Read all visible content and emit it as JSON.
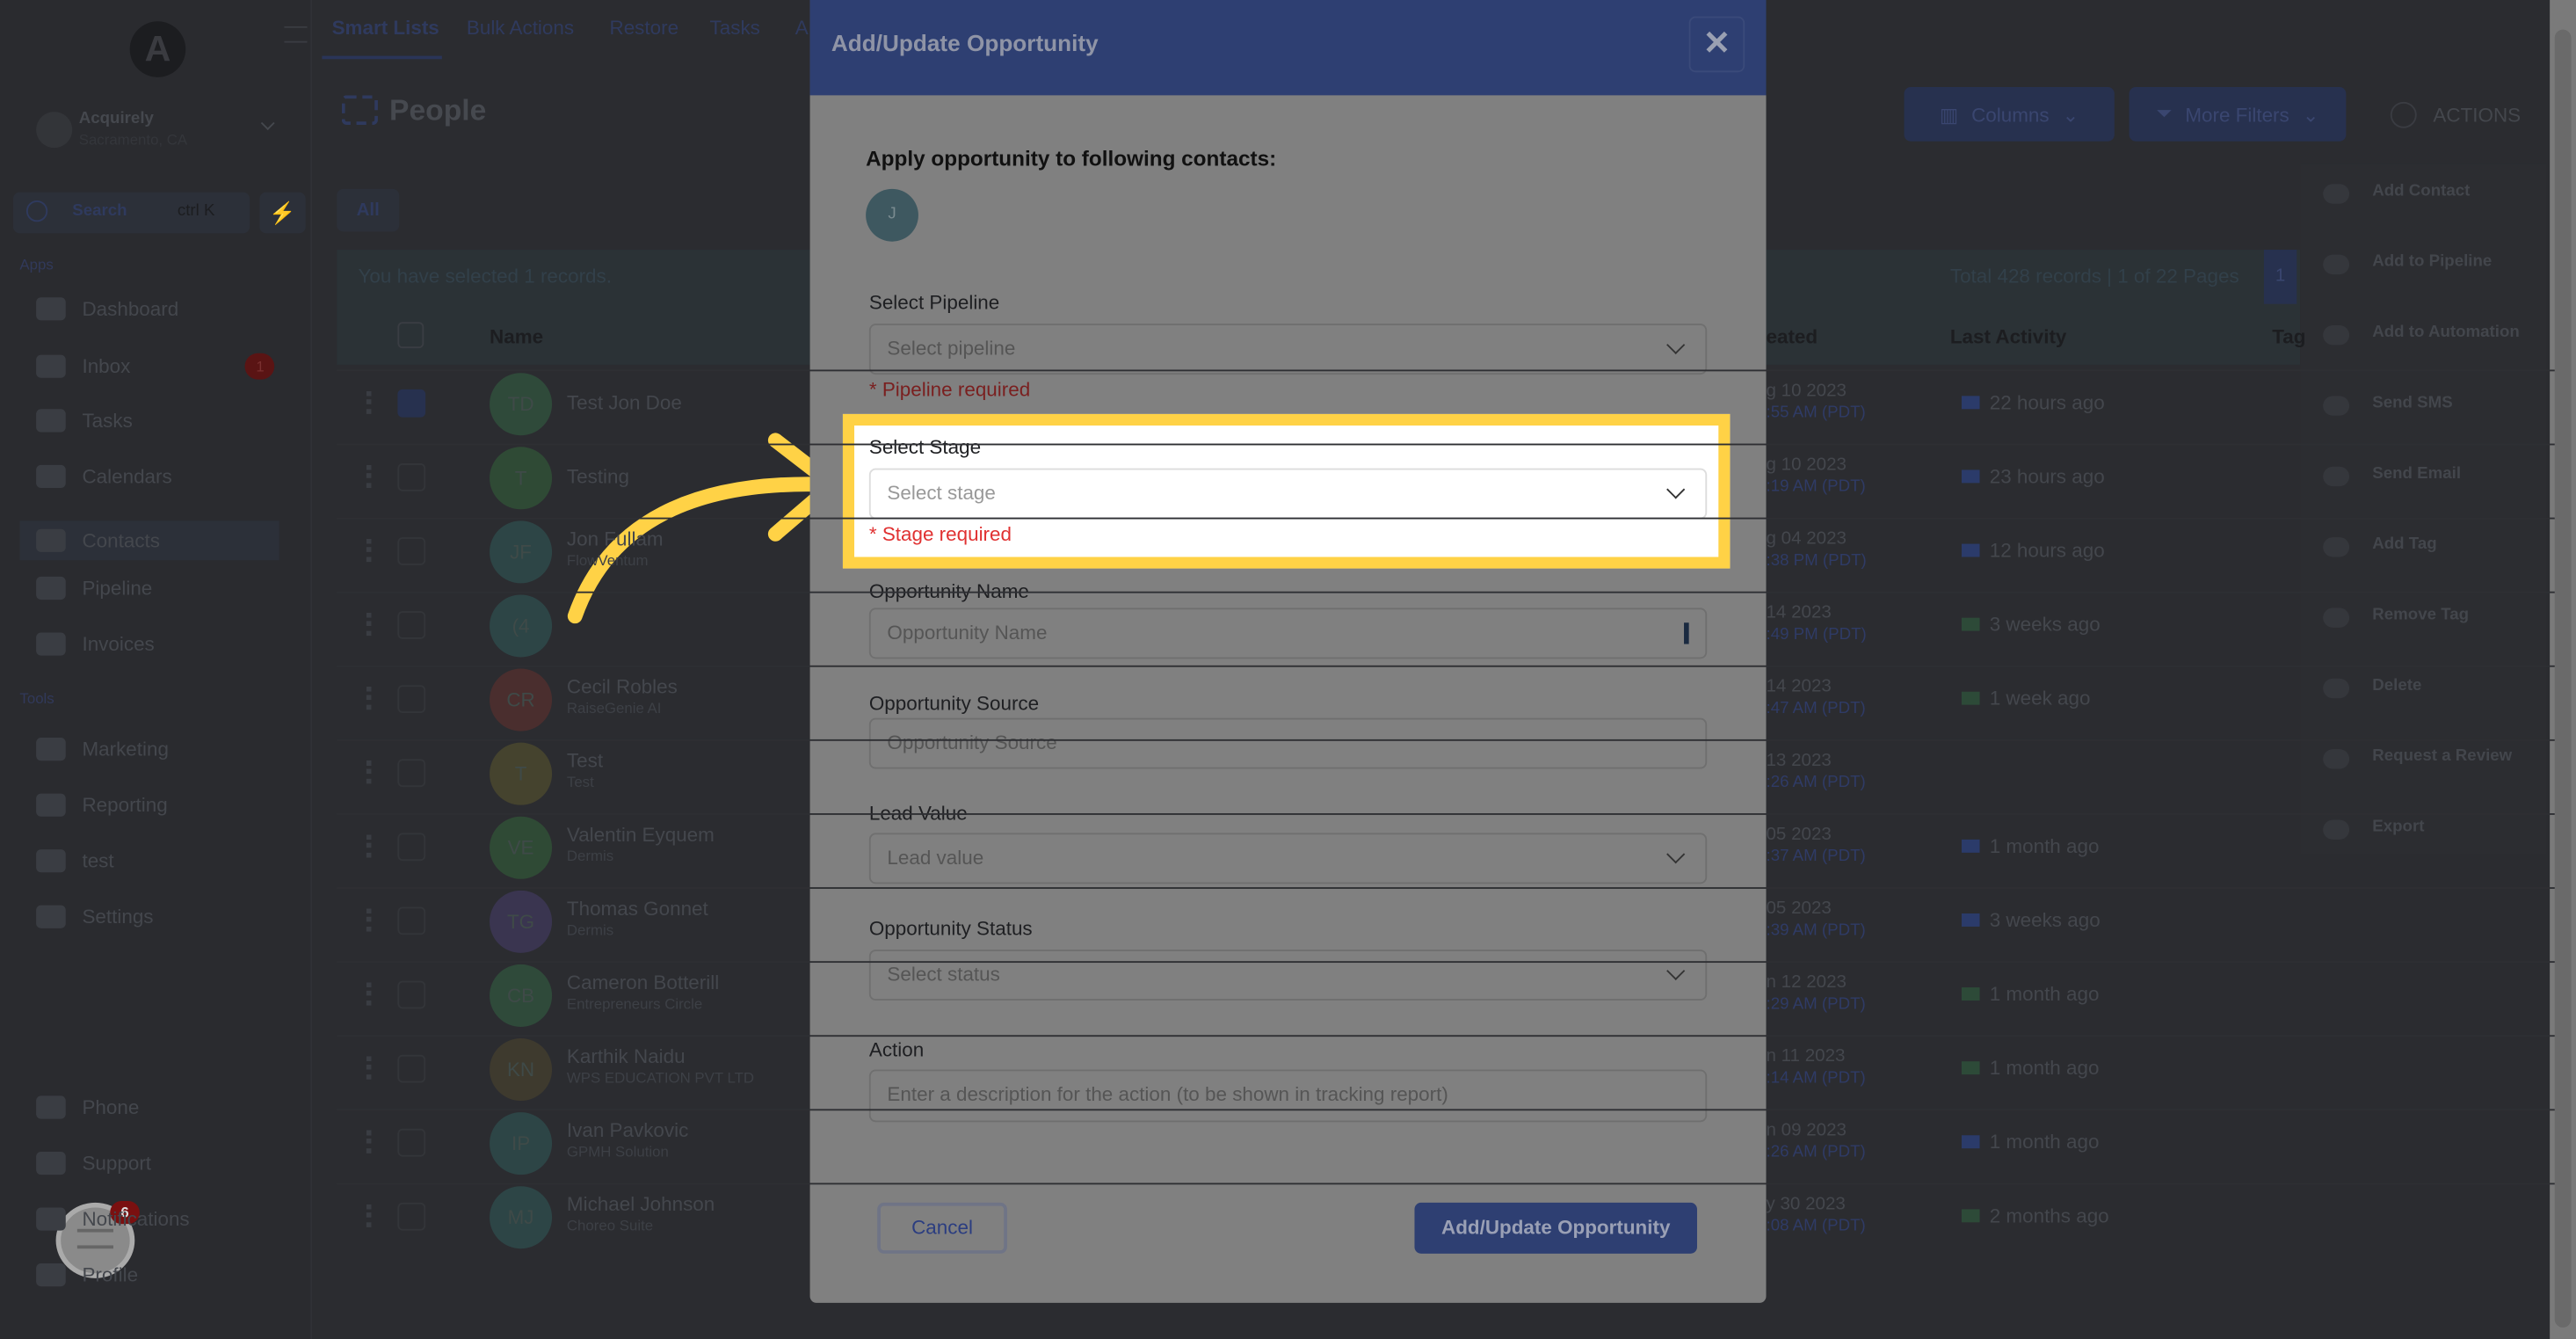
{
  "sidebar": {
    "logo": "A",
    "account_name": "Acquirely",
    "account_location": "Sacramento, CA",
    "search_label": "Search",
    "search_shortcut": "ctrl K",
    "section_apps": "Apps",
    "section_tools": "Tools",
    "apps": [
      {
        "label": "Dashboard"
      },
      {
        "label": "Inbox",
        "badge": "1"
      },
      {
        "label": "Tasks"
      },
      {
        "label": "Calendars"
      },
      {
        "label": "Contacts",
        "active": true
      },
      {
        "label": "Pipeline"
      },
      {
        "label": "Invoices"
      }
    ],
    "tools": [
      {
        "label": "Marketing"
      },
      {
        "label": "Reporting"
      },
      {
        "label": "test"
      },
      {
        "label": "Settings"
      }
    ],
    "bottom": [
      {
        "label": "Phone"
      },
      {
        "label": "Support"
      },
      {
        "label": "Notifications"
      },
      {
        "label": "Profile"
      }
    ],
    "chat_badge": "6"
  },
  "top_tabs": [
    "Smart Lists",
    "Bulk Actions",
    "Restore",
    "Tasks",
    "A"
  ],
  "page_title": "People",
  "toolbar": {
    "columns": "Columns",
    "more_filters": "More Filters",
    "actions": "ACTIONS"
  },
  "actions_menu": [
    "Add Contact",
    "Add to Pipeline",
    "Add to Automation",
    "Send SMS",
    "Send Email",
    "Add Tag",
    "Remove Tag",
    "Delete",
    "Request a Review",
    "Export"
  ],
  "list": {
    "filter_tab": "All",
    "selected_text": "You have selected 1 records.",
    "total_text": "Total 428 records | 1 of 22 Pages",
    "page": "1",
    "headers": {
      "name": "Name",
      "created": "eated",
      "last_activity": "Last Activity",
      "tags": "Tag"
    },
    "rows": [
      {
        "initials": "TD",
        "name": "Test Jon Doe",
        "sub": "",
        "date": "g 10 2023",
        "time": ":55 AM (PDT)",
        "activity": "22 hours ago",
        "icon": "email",
        "color": "#2f4a3a",
        "checked": true
      },
      {
        "initials": "T",
        "name": "Testing",
        "sub": "",
        "date": "g 10 2023",
        "time": ":19 AM (PDT)",
        "activity": "23 hours ago",
        "icon": "email",
        "color": "#2f4a35"
      },
      {
        "initials": "JF",
        "name": "Jon Fullam",
        "sub": "FlowVentum",
        "date": "g 04 2023",
        "time": ":38 PM (PDT)",
        "activity": "12 hours ago",
        "icon": "email",
        "color": "#2d4546"
      },
      {
        "initials": "(4",
        "name": "",
        "sub": "",
        "date": "14 2023",
        "time": ":49 PM (PDT)",
        "activity": "3 weeks ago",
        "icon": "chat",
        "color": "#2d4546"
      },
      {
        "initials": "CR",
        "name": "Cecil Robles",
        "sub": "RaiseGenie AI",
        "date": "14 2023",
        "time": ":47 AM (PDT)",
        "activity": "1 week ago",
        "icon": "chat",
        "color": "#4a2e2e"
      },
      {
        "initials": "T",
        "name": "Test",
        "sub": "Test",
        "date": "13 2023",
        "time": ":26 AM (PDT)",
        "activity": "",
        "icon": "",
        "color": "#45432e"
      },
      {
        "initials": "VE",
        "name": "Valentin Eyquem",
        "sub": "Dermis",
        "date": "05 2023",
        "time": ":37 AM (PDT)",
        "activity": "1 month ago",
        "icon": "email",
        "color": "#2f4a35"
      },
      {
        "initials": "TG",
        "name": "Thomas Gonnet",
        "sub": "Dermis",
        "date": "05 2023",
        "time": ":39 AM (PDT)",
        "activity": "3 weeks ago",
        "icon": "email",
        "color": "#3a3550"
      },
      {
        "initials": "CB",
        "name": "Cameron Botterill",
        "sub": "Entrepreneurs Circle",
        "date": "n 12 2023",
        "time": ":29 AM (PDT)",
        "activity": "1 month ago",
        "icon": "chat",
        "color": "#2f4a3a"
      },
      {
        "initials": "KN",
        "name": "Karthik Naidu",
        "sub": "WPS EDUCATION PVT LTD",
        "date": "n 11 2023",
        "time": ":14 AM (PDT)",
        "activity": "1 month ago",
        "icon": "chat",
        "color": "#3e3a2e"
      },
      {
        "initials": "IP",
        "name": "Ivan Pavkovic",
        "sub": "GPMH Solution",
        "date": "n 09 2023",
        "time": ":26 AM (PDT)",
        "activity": "1 month ago",
        "icon": "email",
        "color": "#2d4546"
      },
      {
        "initials": "MJ",
        "name": "Michael Johnson",
        "sub": "Choreo Suite",
        "date": "y 30 2023",
        "time": ":08 AM (PDT)",
        "activity": "2 months ago",
        "icon": "chat",
        "color": "#2d4546"
      }
    ]
  },
  "modal": {
    "title": "Add/Update Opportunity",
    "apply_heading": "Apply opportunity to following contacts:",
    "contact_initial": "J",
    "fields": {
      "pipeline": {
        "label": "Select Pipeline",
        "placeholder": "Select pipeline",
        "error": "* Pipeline required"
      },
      "stage": {
        "label": "Select Stage",
        "placeholder": "Select stage",
        "error": "* Stage required"
      },
      "name": {
        "label": "Opportunity Name",
        "placeholder": "Opportunity Name"
      },
      "source": {
        "label": "Opportunity Source",
        "placeholder": "Opportunity Source"
      },
      "lead_value": {
        "label": "Lead Value",
        "placeholder": "Lead value"
      },
      "status": {
        "label": "Opportunity Status",
        "placeholder": "Select status"
      },
      "action": {
        "label": "Action",
        "placeholder": "Enter a description for the action (to be shown in tracking report)"
      }
    },
    "cancel": "Cancel",
    "submit": "Add/Update Opportunity"
  },
  "colors": {
    "highlight": "#ffd246",
    "modal_header": "#2e3f72",
    "primary_button": "#2e3f72",
    "error": "#d33"
  }
}
